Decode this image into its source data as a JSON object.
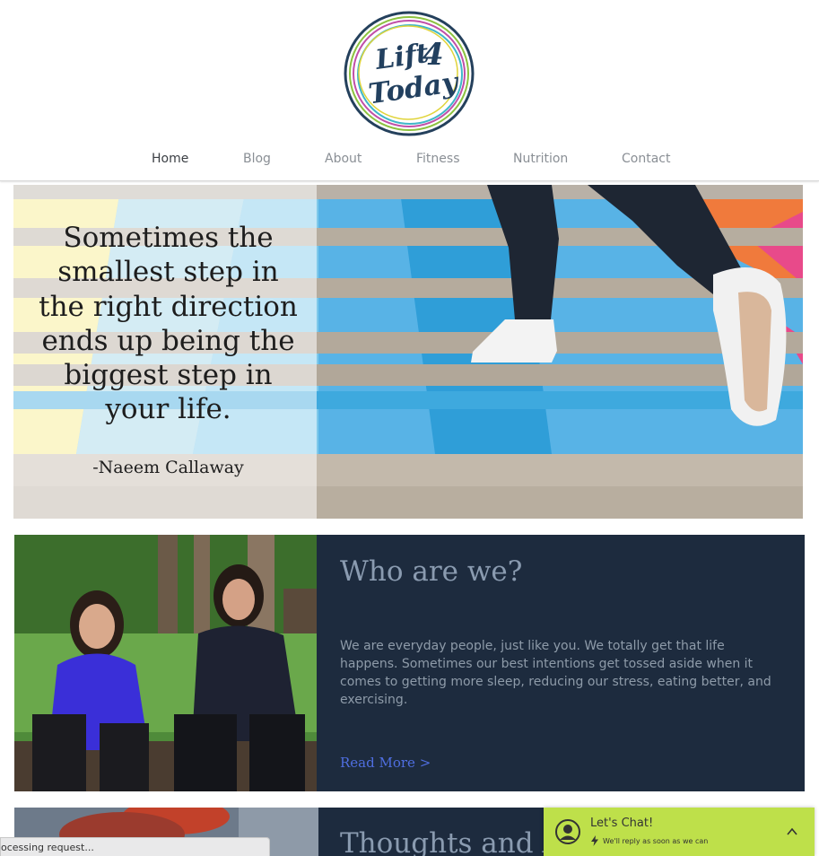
{
  "logo": {
    "line1": "Lift",
    "num": "4",
    "line2": "Today"
  },
  "nav": {
    "items": [
      {
        "label": "Home",
        "active": true
      },
      {
        "label": "Blog",
        "active": false
      },
      {
        "label": "About",
        "active": false
      },
      {
        "label": "Fitness",
        "active": false
      },
      {
        "label": "Nutrition",
        "active": false
      },
      {
        "label": "Contact",
        "active": false
      }
    ]
  },
  "hero": {
    "quote_lines": [
      "Sometimes the",
      "smallest step in",
      "the right direction",
      "ends up being the",
      "biggest step in",
      "your life."
    ],
    "author": "-Naeem Callaway"
  },
  "who": {
    "title": "Who are we?",
    "body": "We are everyday people, just like you. We totally get that life happens.  Sometimes our best intentions get tossed aside when it comes to getting more sleep, reducing our stress, eating better, and exercising.",
    "read_more": "Read More >"
  },
  "thoughts": {
    "title": "Thoughts and A"
  },
  "status": {
    "text": "ocessing request..."
  },
  "chat": {
    "title": "Let's Chat!",
    "subtitle": "We'll reply as soon as we can",
    "icon": "user-icon"
  },
  "colors": {
    "nav_active": "#3b3f44",
    "nav_inactive": "#8a8f95",
    "dark_panel": "#1d2b3e",
    "link_blue": "#4f6ee0",
    "chat_green": "#bee04a",
    "logo_blue": "#22405f"
  }
}
